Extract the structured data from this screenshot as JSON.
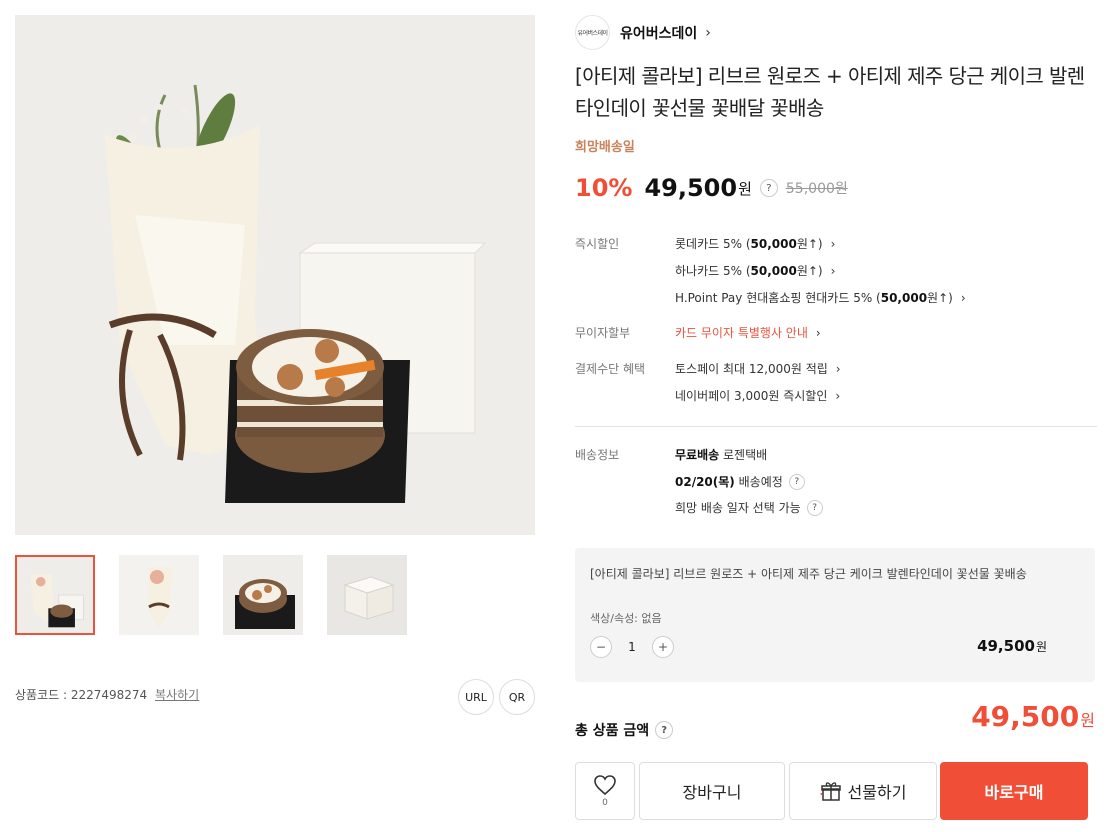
{
  "store": {
    "logo_text": "유어버스데이",
    "name": "유어버스데이"
  },
  "product": {
    "title": "[아티제 콜라보] 리브르 원로즈 + 아티제 제주 당근 케이크 발렌타인데이 꽃선물 꽃배달 꽃배송",
    "wish_date_label": "희망배송일",
    "discount": "10%",
    "price": "49,500",
    "currency": "원",
    "original_price": "55,000원",
    "code_label": "상품코드 : 2227498274",
    "copy_label": "복사하기"
  },
  "share": {
    "url_label": "URL",
    "qr_label": "QR"
  },
  "instant_discount": {
    "label": "즉시할인",
    "items": [
      {
        "pre": "롯데카드 5% (",
        "bold": "50,000",
        "post": "원↑)"
      },
      {
        "pre": "하나카드 5% (",
        "bold": "50,000",
        "post": "원↑)"
      },
      {
        "pre": "H.Point Pay 현대홈쇼핑 현대카드 5% (",
        "bold": "50,000",
        "post": "원↑)"
      }
    ]
  },
  "installment": {
    "label": "무이자할부",
    "text": "카드 무이자 특별행사 안내"
  },
  "payment_benefit": {
    "label": "결제수단 혜택",
    "items": [
      "토스페이 최대 12,000원 적립",
      "네이버페이 3,000원 즉시할인"
    ]
  },
  "shipping": {
    "label": "배송정보",
    "free": "무료배송",
    "carrier": "로젠택배",
    "date": "02/20(목)",
    "date_suffix": "배송예정",
    "wish_note": "희망 배송 일자 선택 가능"
  },
  "option": {
    "title": "[아티제 콜라보] 리브르 원로즈 + 아티제 제주 당근 케이크 발렌타인데이 꽃선물 꽃배송",
    "attr": "색상/속성: 없음",
    "qty": "1",
    "price": "49,500",
    "currency": "원"
  },
  "total": {
    "label": "총 상품 금액",
    "price": "49,500",
    "currency": "원"
  },
  "buttons": {
    "wish_count": "0",
    "cart": "장바구니",
    "gift": "선물하기",
    "buy": "바로구매"
  },
  "colors": {
    "accent": "#f04e37",
    "wish_date": "#c9825a",
    "installment": "#e8553e"
  },
  "icons": [
    "help-icon",
    "chevron-right-icon",
    "heart-icon",
    "gift-icon",
    "minus-icon",
    "plus-icon"
  ]
}
